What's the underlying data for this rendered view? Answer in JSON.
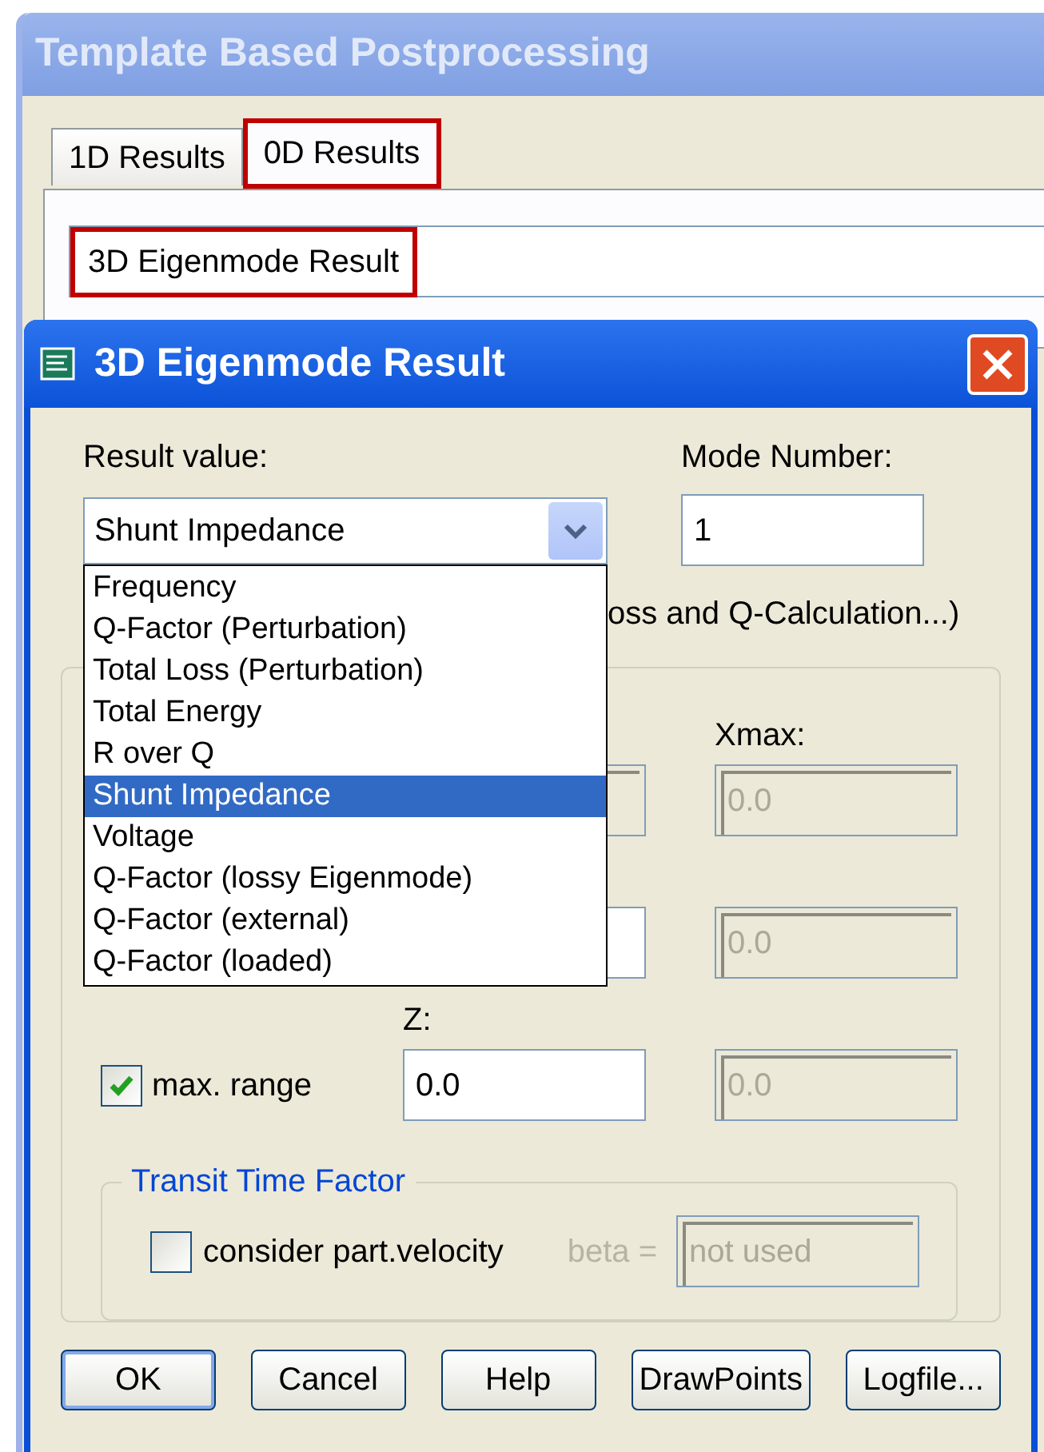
{
  "window": {
    "title": "Template Based Postprocessing"
  },
  "tabs": [
    {
      "label": "1D Results",
      "selected": false,
      "highlighted": false
    },
    {
      "label": "0D Results",
      "selected": true,
      "highlighted": true
    }
  ],
  "template_combo": {
    "value": "3D Eigenmode Result",
    "highlighted": true
  },
  "dialog": {
    "title": "3D Eigenmode Result",
    "result_value": {
      "label": "Result value:",
      "value": "Shunt Impedance",
      "expanded": true,
      "options": [
        {
          "label": "Frequency",
          "selected": false
        },
        {
          "label": "Q-Factor (Perturbation)",
          "selected": false
        },
        {
          "label": "Total Loss (Perturbation)",
          "selected": false
        },
        {
          "label": "Total Energy",
          "selected": false
        },
        {
          "label": "R over Q",
          "selected": false
        },
        {
          "label": "Shunt Impedance",
          "selected": true
        },
        {
          "label": "Voltage",
          "selected": false
        },
        {
          "label": "Q-Factor (lossy Eigenmode)",
          "selected": false
        },
        {
          "label": "Q-Factor (external)",
          "selected": false
        },
        {
          "label": "Q-Factor (loaded)",
          "selected": false
        }
      ]
    },
    "mode_number": {
      "label": "Mode Number:",
      "value": "1"
    },
    "covered_button_text": "oss and Q-Calculation...)",
    "range_rows": [
      {
        "max_label": "Xmax:",
        "min_disabled": true,
        "max": {
          "value": "0.0",
          "disabled": true
        }
      },
      {
        "min_disabled": false,
        "max": {
          "value": "0.0",
          "disabled": true
        }
      },
      {
        "min_label": "Z:",
        "min": {
          "value": "0.0",
          "disabled": false
        },
        "max": {
          "value": "0.0",
          "disabled": true
        }
      }
    ],
    "max_range": {
      "label": "max. range",
      "checked": true
    },
    "transit_time": {
      "title": "Transit Time Factor",
      "checkbox": {
        "label": "consider part.velocity",
        "checked": false
      },
      "beta_label": "beta =",
      "beta": {
        "value": "not used",
        "disabled": true
      }
    },
    "buttons": [
      {
        "label": "OK",
        "default": true
      },
      {
        "label": "Cancel",
        "default": false
      },
      {
        "label": "Help",
        "default": false
      },
      {
        "label": "DrawPoints",
        "default": false
      },
      {
        "label": "Logfile...",
        "default": false
      }
    ]
  }
}
